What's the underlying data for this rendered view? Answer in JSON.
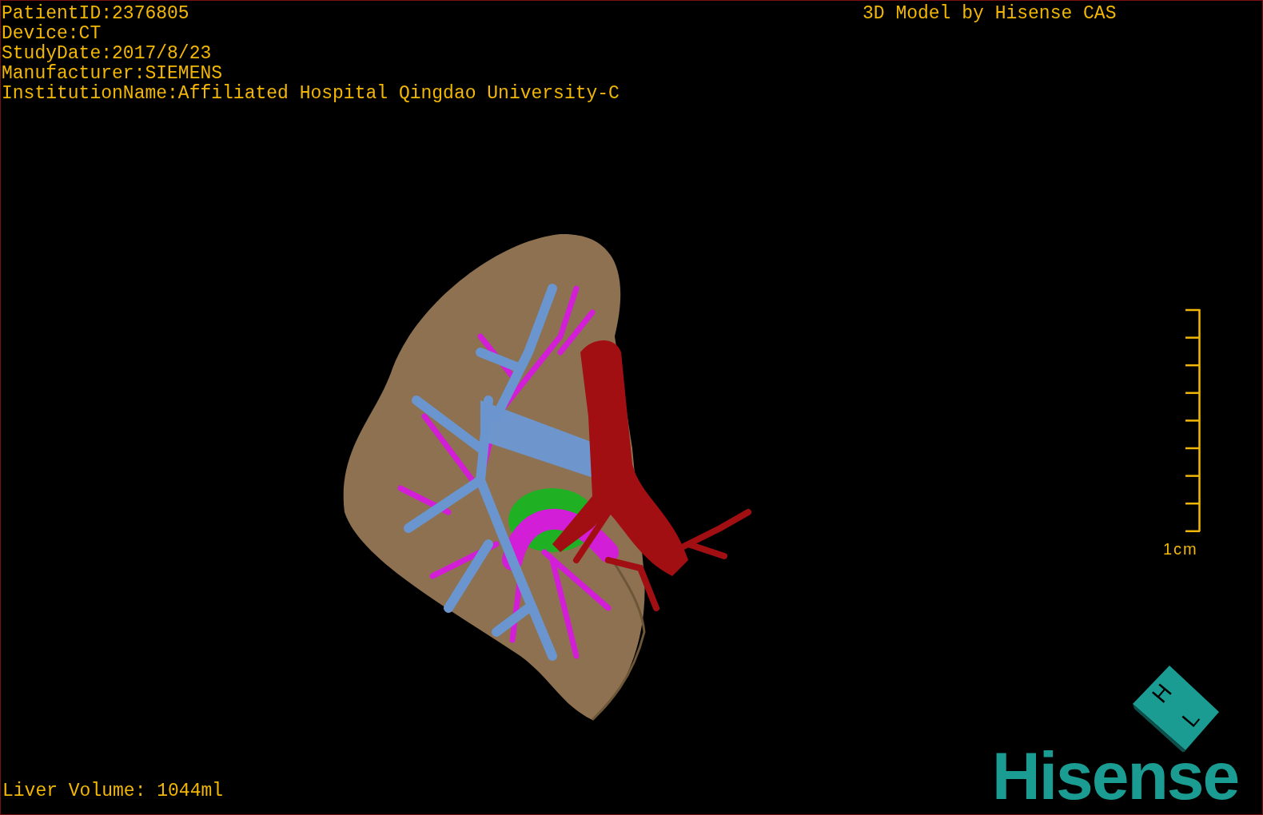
{
  "patient_info": [
    "PatientID:2376805",
    "Device:CT",
    "StudyDate:2017/8/23",
    "Manufacturer:SIEMENS",
    "InstitutionName:Affiliated Hospital Qingdao University-C"
  ],
  "header_title": "3D Model by Hisense CAS",
  "scale_bar": {
    "label": "1cm"
  },
  "liver_volume": "Liver Volume: 1044ml",
  "orientation_cube": {
    "labels": [
      "H",
      "L"
    ]
  },
  "logo": "Hisense"
}
